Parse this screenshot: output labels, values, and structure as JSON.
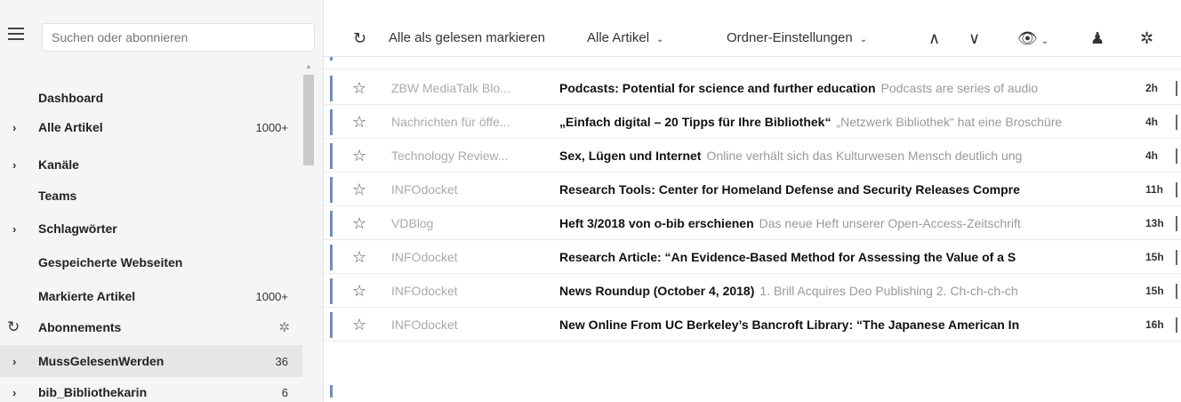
{
  "search": {
    "placeholder": "Suchen oder abonnieren"
  },
  "sidebar": {
    "items": [
      {
        "label": "Dashboard",
        "count": "",
        "chevron": false
      },
      {
        "label": "Alle Artikel",
        "count": "1000+",
        "chevron": true
      },
      {
        "label": "Kanäle",
        "count": "",
        "chevron": true
      },
      {
        "label": "Teams",
        "count": "",
        "chevron": false
      },
      {
        "label": "Schlagwörter",
        "count": "",
        "chevron": true
      },
      {
        "label": "Gespeicherte Webseiten",
        "count": "",
        "chevron": false
      },
      {
        "label": "Markierte Artikel",
        "count": "1000+",
        "chevron": false
      },
      {
        "label": "Abonnements",
        "count": "",
        "icon": "refresh-icon",
        "action_icon": "gear-icon"
      },
      {
        "label": "MussGelesenWerden",
        "count": "36",
        "chevron": true,
        "selected": true
      },
      {
        "label": "bib_Bibliothekarin",
        "count": "6",
        "chevron": true
      }
    ]
  },
  "toolbar": {
    "refresh_icon": "refresh-icon",
    "mark_all_read": "Alle als gelesen markieren",
    "filter": "Alle Artikel",
    "folder_settings": "Ordner-Einstellungen",
    "prev_icon": "chevron-up-icon",
    "next_icon": "chevron-down-icon",
    "view_icon": "eye-icon",
    "notify_icon": "bell-icon",
    "settings_icon": "gear-icon"
  },
  "articles": [
    {
      "feed": "ZBW MediaTalk Blo...",
      "title": "Podcasts: Potential for science and further education",
      "excerpt": "Podcasts are series of audio",
      "age": "2h"
    },
    {
      "feed": "Nachrichten für öffe...",
      "title": "„Einfach digital – 20 Tipps für Ihre Bibliothek“",
      "excerpt": "„Netzwerk Bibliothek“ hat eine Broschüre",
      "age": "4h"
    },
    {
      "feed": "Technology Review...",
      "title": "Sex, Lügen und Internet",
      "excerpt": "Online verhält sich das Kulturwesen Mensch deutlich ung",
      "age": "4h"
    },
    {
      "feed": "INFOdocket",
      "title": "Research Tools: Center for Homeland Defense and Security Releases Compre",
      "excerpt": "",
      "age": "11h"
    },
    {
      "feed": "VDBlog",
      "title": "Heft 3/2018 von o-bib erschienen",
      "excerpt": "Das neue Heft unserer Open-Access-Zeitschrift",
      "age": "13h"
    },
    {
      "feed": "INFOdocket",
      "title": "Research Article: “An Evidence-Based Method for Assessing the Value of a S",
      "excerpt": "",
      "age": "15h"
    },
    {
      "feed": "INFOdocket",
      "title": "News Roundup (October 4, 2018)",
      "excerpt": "1. Brill Acquires Deo Publishing 2. Ch-ch-ch-ch",
      "age": "15h"
    },
    {
      "feed": "INFOdocket",
      "title": "New Online From UC Berkeley’s Bancroft Library: “The Japanese American In",
      "excerpt": "",
      "age": "16h"
    }
  ],
  "colors": {
    "unread_marker": "#6a8fc7",
    "selected_bg": "#e6e6e6"
  }
}
